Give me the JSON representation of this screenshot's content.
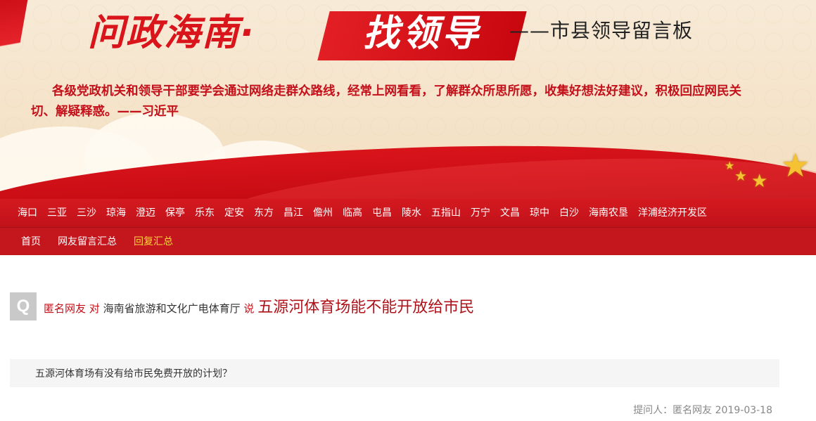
{
  "banner": {
    "title_main": "问政海南·",
    "title_highlight": "找领导",
    "subtitle": "——市县领导留言板",
    "quote": "各级党政机关和领导干部要学会通过网络走群众路线，经常上网看看，了解群众所思所愿，收集好想法好建议，积极回应网民关切、解疑释惑。——习近平"
  },
  "nav_cities": [
    "海口",
    "三亚",
    "三沙",
    "琼海",
    "澄迈",
    "保亭",
    "乐东",
    "定安",
    "东方",
    "昌江",
    "儋州",
    "临高",
    "屯昌",
    "陵水",
    "五指山",
    "万宁",
    "文昌",
    "琼中",
    "白沙",
    "海南农垦",
    "洋浦经济开发区"
  ],
  "nav_main": [
    "首页",
    "网友留言汇总",
    "回复汇总"
  ],
  "nav_main_active_index": 2,
  "question": {
    "badge": "Q",
    "asker": "匿名网友",
    "to_word": "对",
    "target": "海南省旅游和文化广电体育厅",
    "say_word": "说",
    "title": "五源河体育场能不能开放给市民",
    "detail": "五源河体育场有没有给市民免费开放的计划？",
    "meta": "提问人：匿名网友 2019-03-18"
  },
  "colors": {
    "brand_red": "#c3161d",
    "active_nav": "#fdd73a",
    "title_red": "#b01219"
  }
}
